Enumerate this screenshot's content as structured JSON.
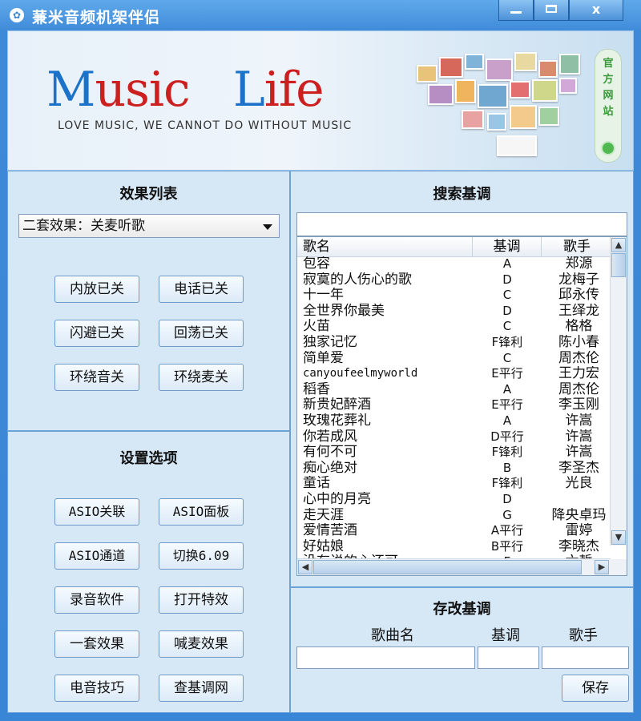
{
  "window": {
    "title": "蒹米音频机架伴侣",
    "min_label": "",
    "max_label": "",
    "close_label": "x"
  },
  "banner": {
    "logo_word1_first": "M",
    "logo_word1_rest": "usic",
    "logo_word2_first": "L",
    "logo_word2_rest": "ife",
    "slogan": "LOVE MUSIC, WE CANNOT DO WITHOUT MUSIC",
    "site_link": "官方网站"
  },
  "effects": {
    "title": "效果列表",
    "selected_preset": "二套效果：关麦听歌",
    "buttons": [
      "内放已关",
      "电话已关",
      "闪避已关",
      "回荡已关",
      "环绕音关",
      "环绕麦关"
    ]
  },
  "settings": {
    "title": "设置选项",
    "buttons": [
      "ASIO关联",
      "ASIO面板",
      "ASIO通道",
      "切换6.09",
      "录音软件",
      "打开特效",
      "一套效果",
      "喊麦效果",
      "电音技巧",
      "查基调网"
    ]
  },
  "search": {
    "title": "搜索基调",
    "input_value": "",
    "columns": [
      "歌名",
      "基调",
      "歌手"
    ],
    "rows": [
      [
        "包容",
        "A",
        "郑源"
      ],
      [
        "寂寞的人伤心的歌",
        "D",
        "龙梅子"
      ],
      [
        "十一年",
        "C",
        "邱永传"
      ],
      [
        "全世界你最美",
        "D",
        "王绎龙"
      ],
      [
        "火苗",
        "C",
        "格格"
      ],
      [
        "独家记忆",
        "F锋利",
        "陈小春"
      ],
      [
        "简单爱",
        "C",
        "周杰伦"
      ],
      [
        "canyoufeelmyworld",
        "E平行",
        "王力宏"
      ],
      [
        "稻香",
        "A",
        "周杰伦"
      ],
      [
        "新贵妃醉酒",
        "E平行",
        "李玉刚"
      ],
      [
        "玫瑰花葬礼",
        "A",
        "许嵩"
      ],
      [
        "你若成风",
        "D平行",
        "许嵩"
      ],
      [
        "有何不可",
        "F锋利",
        "许嵩"
      ],
      [
        "痴心绝对",
        "B",
        "李圣杰"
      ],
      [
        "童话",
        "F锋利",
        "光良"
      ],
      [
        "心中的月亮",
        "D",
        ""
      ],
      [
        "走天涯",
        "G",
        "降央卓玛"
      ],
      [
        "爱情苦酒",
        "A平行",
        "雷婷"
      ],
      [
        "好姑娘",
        "B平行",
        "李晓杰"
      ],
      [
        "没有说的心还可",
        "F",
        "六哲"
      ]
    ]
  },
  "edit": {
    "title": "存改基调",
    "song_label": "歌曲名",
    "key_label": "基调",
    "singer_label": "歌手",
    "song_value": "",
    "key_value": "",
    "singer_value": "",
    "save_label": "保存"
  },
  "colors": {
    "accent_blue": "#1b72c8",
    "logo_red": "#cc2020",
    "panel_bg": "#d6e7f6",
    "titlebar": "#3a86d6"
  }
}
